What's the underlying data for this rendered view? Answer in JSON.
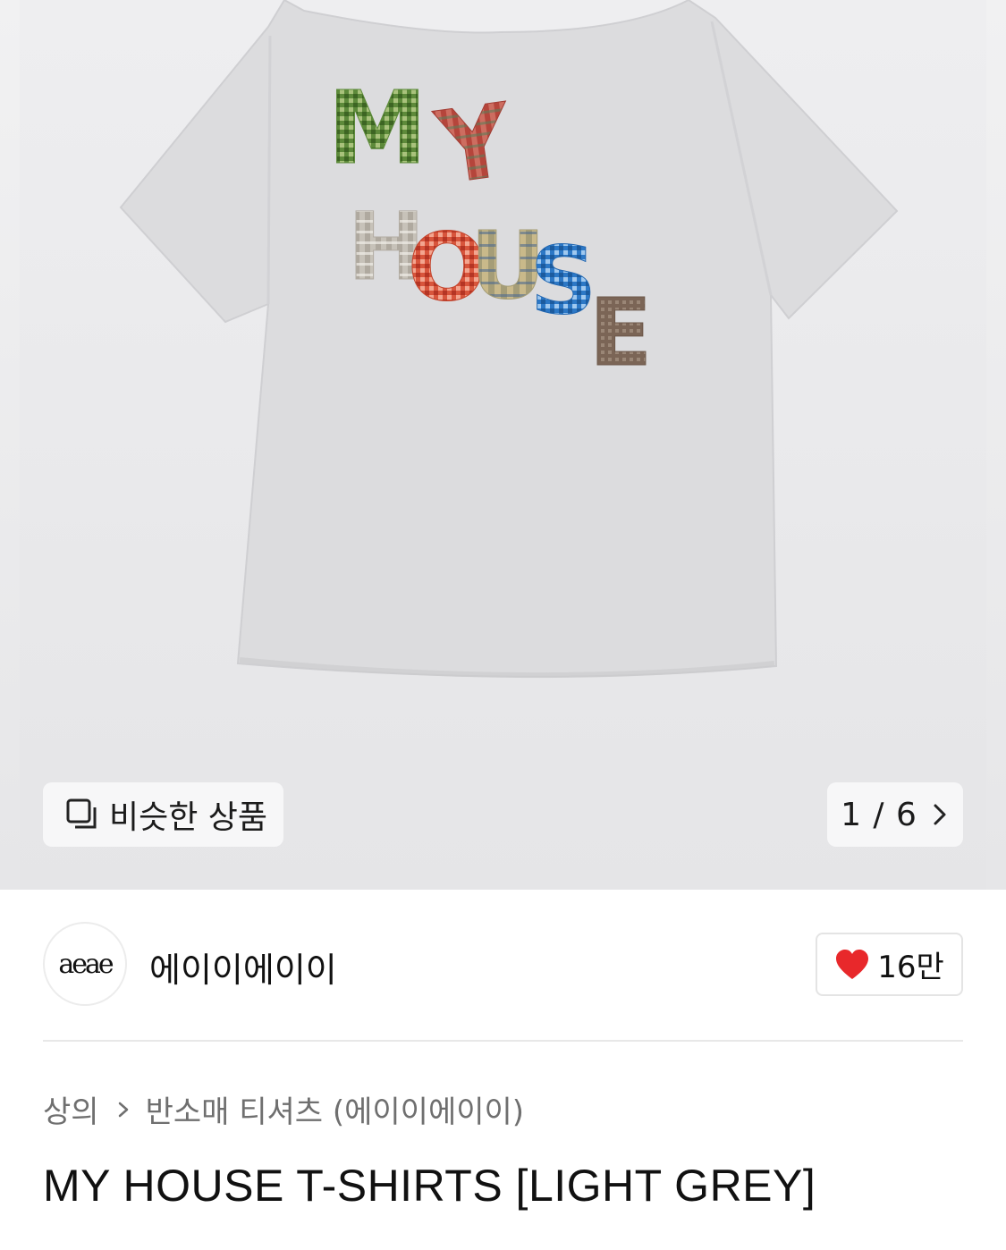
{
  "gallery": {
    "similar_label": "비슷한 상품",
    "counter": "1 / 6",
    "graphic_text": "MY HOUSE"
  },
  "brand": {
    "logo_text": "aeae",
    "name": "에이이에이이",
    "like_count": "16만"
  },
  "breadcrumb": {
    "items": [
      "상의",
      "반소매 티셔츠 (에이이에이이)"
    ]
  },
  "product": {
    "title": "MY HOUSE T-SHIRTS [LIGHT GREY]"
  },
  "colors": {
    "heart": "#e8282b",
    "shirt": "#dcdcde"
  }
}
